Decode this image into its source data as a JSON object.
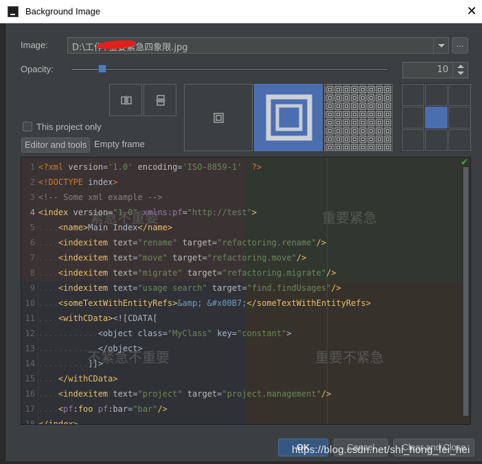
{
  "window": {
    "title": "Background Image",
    "close_glyph": "✕"
  },
  "image": {
    "label": "Image:",
    "path": "D:\\工作\\          重要紧急四象限.jpg",
    "browse_label": "..."
  },
  "opacity": {
    "label": "Opacity:",
    "value": "10",
    "percent": 10
  },
  "options": {
    "this_project_only": "This project only",
    "this_project_only_checked": false
  },
  "target_tabs": [
    {
      "label": "Editor and tools",
      "selected": true
    },
    {
      "label": "Empty frame",
      "selected": false
    }
  ],
  "fill_modes": [
    "center",
    "scale",
    "tile"
  ],
  "selected_fill_mode": "scale",
  "anchor_selected": "center",
  "preview": {
    "quadrants": {
      "top_left": "紧急不重要",
      "top_right": "重要紧急",
      "bottom_left": "不紧急不重要",
      "bottom_right": "重要不紧急"
    },
    "line_numbers": [
      "1",
      "2",
      "3",
      "4",
      "5",
      "6",
      "7",
      "8",
      "9",
      "10",
      "11",
      "12",
      "13",
      "14",
      "15",
      "16",
      "17",
      "18"
    ]
  },
  "buttons": {
    "ok": "OK",
    "cancel": "Cancel",
    "clear_and_close": "Clear and Close"
  },
  "watermark": "https://blog.csdn.net/shi_hong_fei_hei",
  "colors": {
    "background": "#3c3f41",
    "accent": "#4b6eaf",
    "ok_button": "#365880"
  }
}
